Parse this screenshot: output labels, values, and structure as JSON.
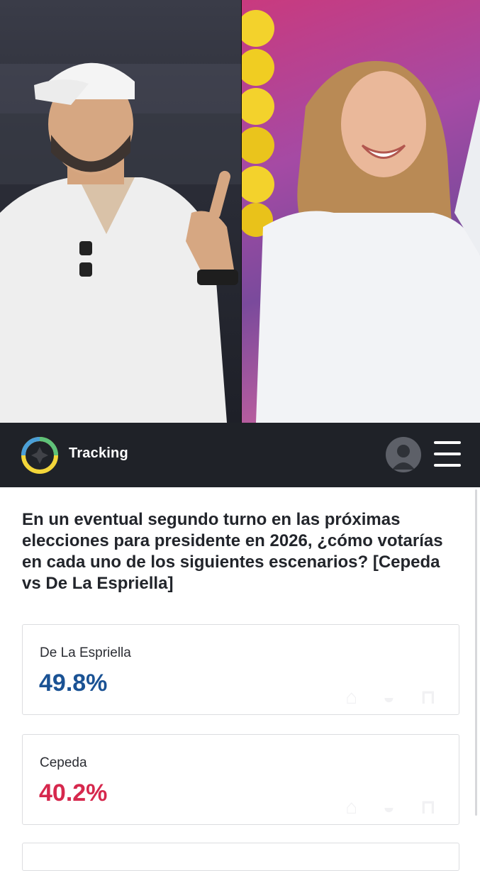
{
  "header": {
    "brand": "Tracking",
    "icons": {
      "logo": "compass-logo-icon",
      "avatar": "user-avatar-icon",
      "menu": "hamburger-menu-icon"
    }
  },
  "survey": {
    "question": "En un eventual segundo turno en las próximas elecciones para presidente en 2026, ¿cómo votarías en cada uno de los siguientes escenarios? [Cepeda vs De La Espriella]",
    "results": [
      {
        "name": "De La Espriella",
        "value": "49.8%",
        "color": "#1a5294"
      },
      {
        "name": "Cepeda",
        "value": "40.2%",
        "color": "#d6284d"
      }
    ]
  },
  "colors": {
    "appbar": "#1f2228",
    "accent_blue": "#1a5294",
    "accent_red": "#d6284d"
  }
}
